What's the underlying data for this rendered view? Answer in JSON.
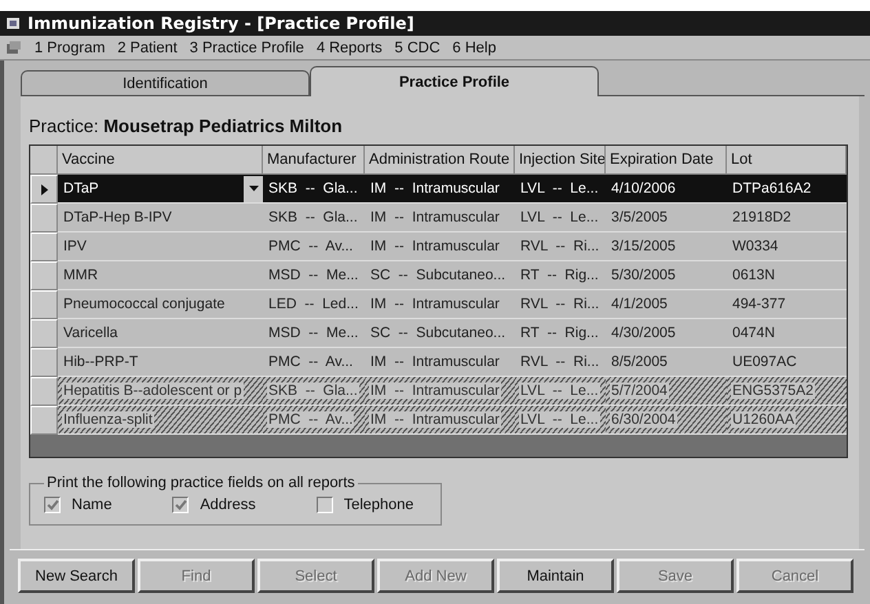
{
  "window": {
    "title": "Immunization Registry  - [Practice Profile]"
  },
  "menu": [
    "1 Program",
    "2 Patient",
    "3 Practice Profile",
    "4 Reports",
    "5 CDC",
    "6 Help"
  ],
  "tabs": [
    {
      "label": "Identification",
      "selected": false
    },
    {
      "label": "Practice Profile",
      "selected": true
    }
  ],
  "practice": {
    "label": "Practice:",
    "name": "Mousetrap Pediatrics Milton"
  },
  "table": {
    "columns": [
      "Vaccine",
      "Manufacturer",
      "Administration Route",
      "Injection Site",
      "Expiration Date",
      "Lot"
    ],
    "rows": [
      {
        "cells": [
          "DTaP",
          "SKB  --  Gla...",
          "IM  --  Intramuscular",
          "LVL  --  Le...",
          "4/10/2006",
          "DTPa616A2"
        ],
        "selected": true,
        "inactive": false
      },
      {
        "cells": [
          "DTaP-Hep B-IPV",
          "SKB  --  Gla...",
          "IM  --  Intramuscular",
          "LVL  --  Le...",
          "3/5/2005",
          "21918D2"
        ],
        "selected": false,
        "inactive": false
      },
      {
        "cells": [
          "IPV",
          "PMC  --  Av...",
          "IM  --  Intramuscular",
          "RVL  --  Ri...",
          "3/15/2005",
          "W0334"
        ],
        "selected": false,
        "inactive": false
      },
      {
        "cells": [
          "MMR",
          "MSD  --  Me...",
          "SC  --  Subcutaneo...",
          "RT  --  Rig...",
          "5/30/2005",
          "0613N"
        ],
        "selected": false,
        "inactive": false
      },
      {
        "cells": [
          "Pneumococcal conjugate",
          "LED  --  Led...",
          "IM  --  Intramuscular",
          "RVL  --  Ri...",
          "4/1/2005",
          "494-377"
        ],
        "selected": false,
        "inactive": false
      },
      {
        "cells": [
          "Varicella",
          "MSD  --  Me...",
          "SC  --  Subcutaneo...",
          "RT  --  Rig...",
          "4/30/2005",
          "0474N"
        ],
        "selected": false,
        "inactive": false
      },
      {
        "cells": [
          "Hib--PRP-T",
          "PMC  --  Av...",
          "IM  --  Intramuscular",
          "RVL  --  Ri...",
          "8/5/2005",
          "UE097AC"
        ],
        "selected": false,
        "inactive": false
      },
      {
        "cells": [
          "Hepatitis B--adolescent or p",
          "SKB  --  Gla...",
          "IM  --  Intramuscular",
          "LVL  --  Le...",
          "5/7/2004",
          "ENG5375A2"
        ],
        "selected": false,
        "inactive": true
      },
      {
        "cells": [
          "Influenza-split",
          "PMC  --  Av...",
          "IM  --  Intramuscular",
          "LVL  --  Le...",
          "6/30/2004",
          "U1260AA"
        ],
        "selected": false,
        "inactive": true
      }
    ]
  },
  "print_fields": {
    "legend": "Print the following practice fields on all reports",
    "options": [
      {
        "label": "Name",
        "checked": true
      },
      {
        "label": "Address",
        "checked": true
      },
      {
        "label": "Telephone",
        "checked": false
      }
    ]
  },
  "buttons": [
    {
      "label": "New Search",
      "disabled": false
    },
    {
      "label": "Find",
      "disabled": true
    },
    {
      "label": "Select",
      "disabled": true
    },
    {
      "label": "Add New",
      "disabled": true
    },
    {
      "label": "Maintain",
      "disabled": false
    },
    {
      "label": "Save",
      "disabled": true
    },
    {
      "label": "Cancel",
      "disabled": true
    }
  ]
}
